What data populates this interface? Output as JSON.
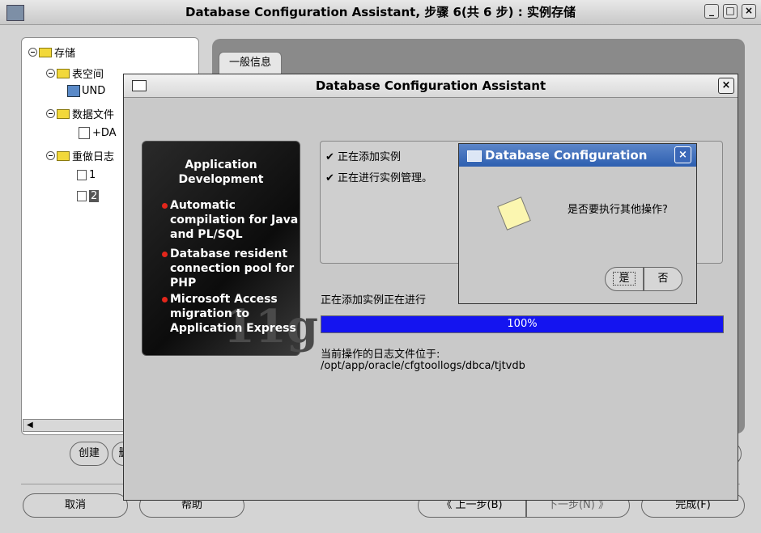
{
  "outer": {
    "title": "Database Configuration Assistant, 步骤 6(共 6 步) : 实例存储",
    "min_glyph": "_",
    "max_glyph": "□",
    "close_glyph": "×"
  },
  "tree": {
    "root": "存储",
    "tablespaces": "表空间",
    "undo": "UND",
    "datafiles": "数据文件",
    "datafile_item": "+DA",
    "redo": "重做日志",
    "redo_1": "1",
    "redo_2": "2"
  },
  "tabs": {
    "general": "一般信息"
  },
  "buttons": {
    "create": "创建",
    "delete": "删",
    "cancel": "取消",
    "help": "帮助",
    "back": "上一步(B)",
    "next": "下一步(N)",
    "finish": "完成(F)",
    "back_arrow": "《",
    "next_arrow": "》"
  },
  "dialog": {
    "title": "Database Configuration Assistant",
    "close_glyph": "×",
    "promo": {
      "heading": "Application Development",
      "bullets": [
        "Automatic compilation for Java and PL/SQL",
        "Database resident connection pool for PHP",
        "Microsoft Access migration to Application Express"
      ],
      "logo": "11g"
    },
    "steps": [
      "✔ 正在添加实例",
      "✔ 正在进行实例管理。"
    ],
    "progress_label": "正在添加实例正在进行",
    "progress": {
      "percent": 100,
      "text": "100%"
    },
    "log_label": "当前操作的日志文件位于:",
    "log_path": "/opt/app/oracle/cfgtoollogs/dbca/tjtvdb"
  },
  "confirm": {
    "title": "Database Configuration",
    "message": "是否要执行其他操作?",
    "yes": "是",
    "no": "否",
    "close_glyph": "×"
  },
  "colors": {
    "progress_fill": "#1414f0",
    "confirm_titlebar": "#2d5fb0",
    "bullet_red": "#e3261b"
  }
}
